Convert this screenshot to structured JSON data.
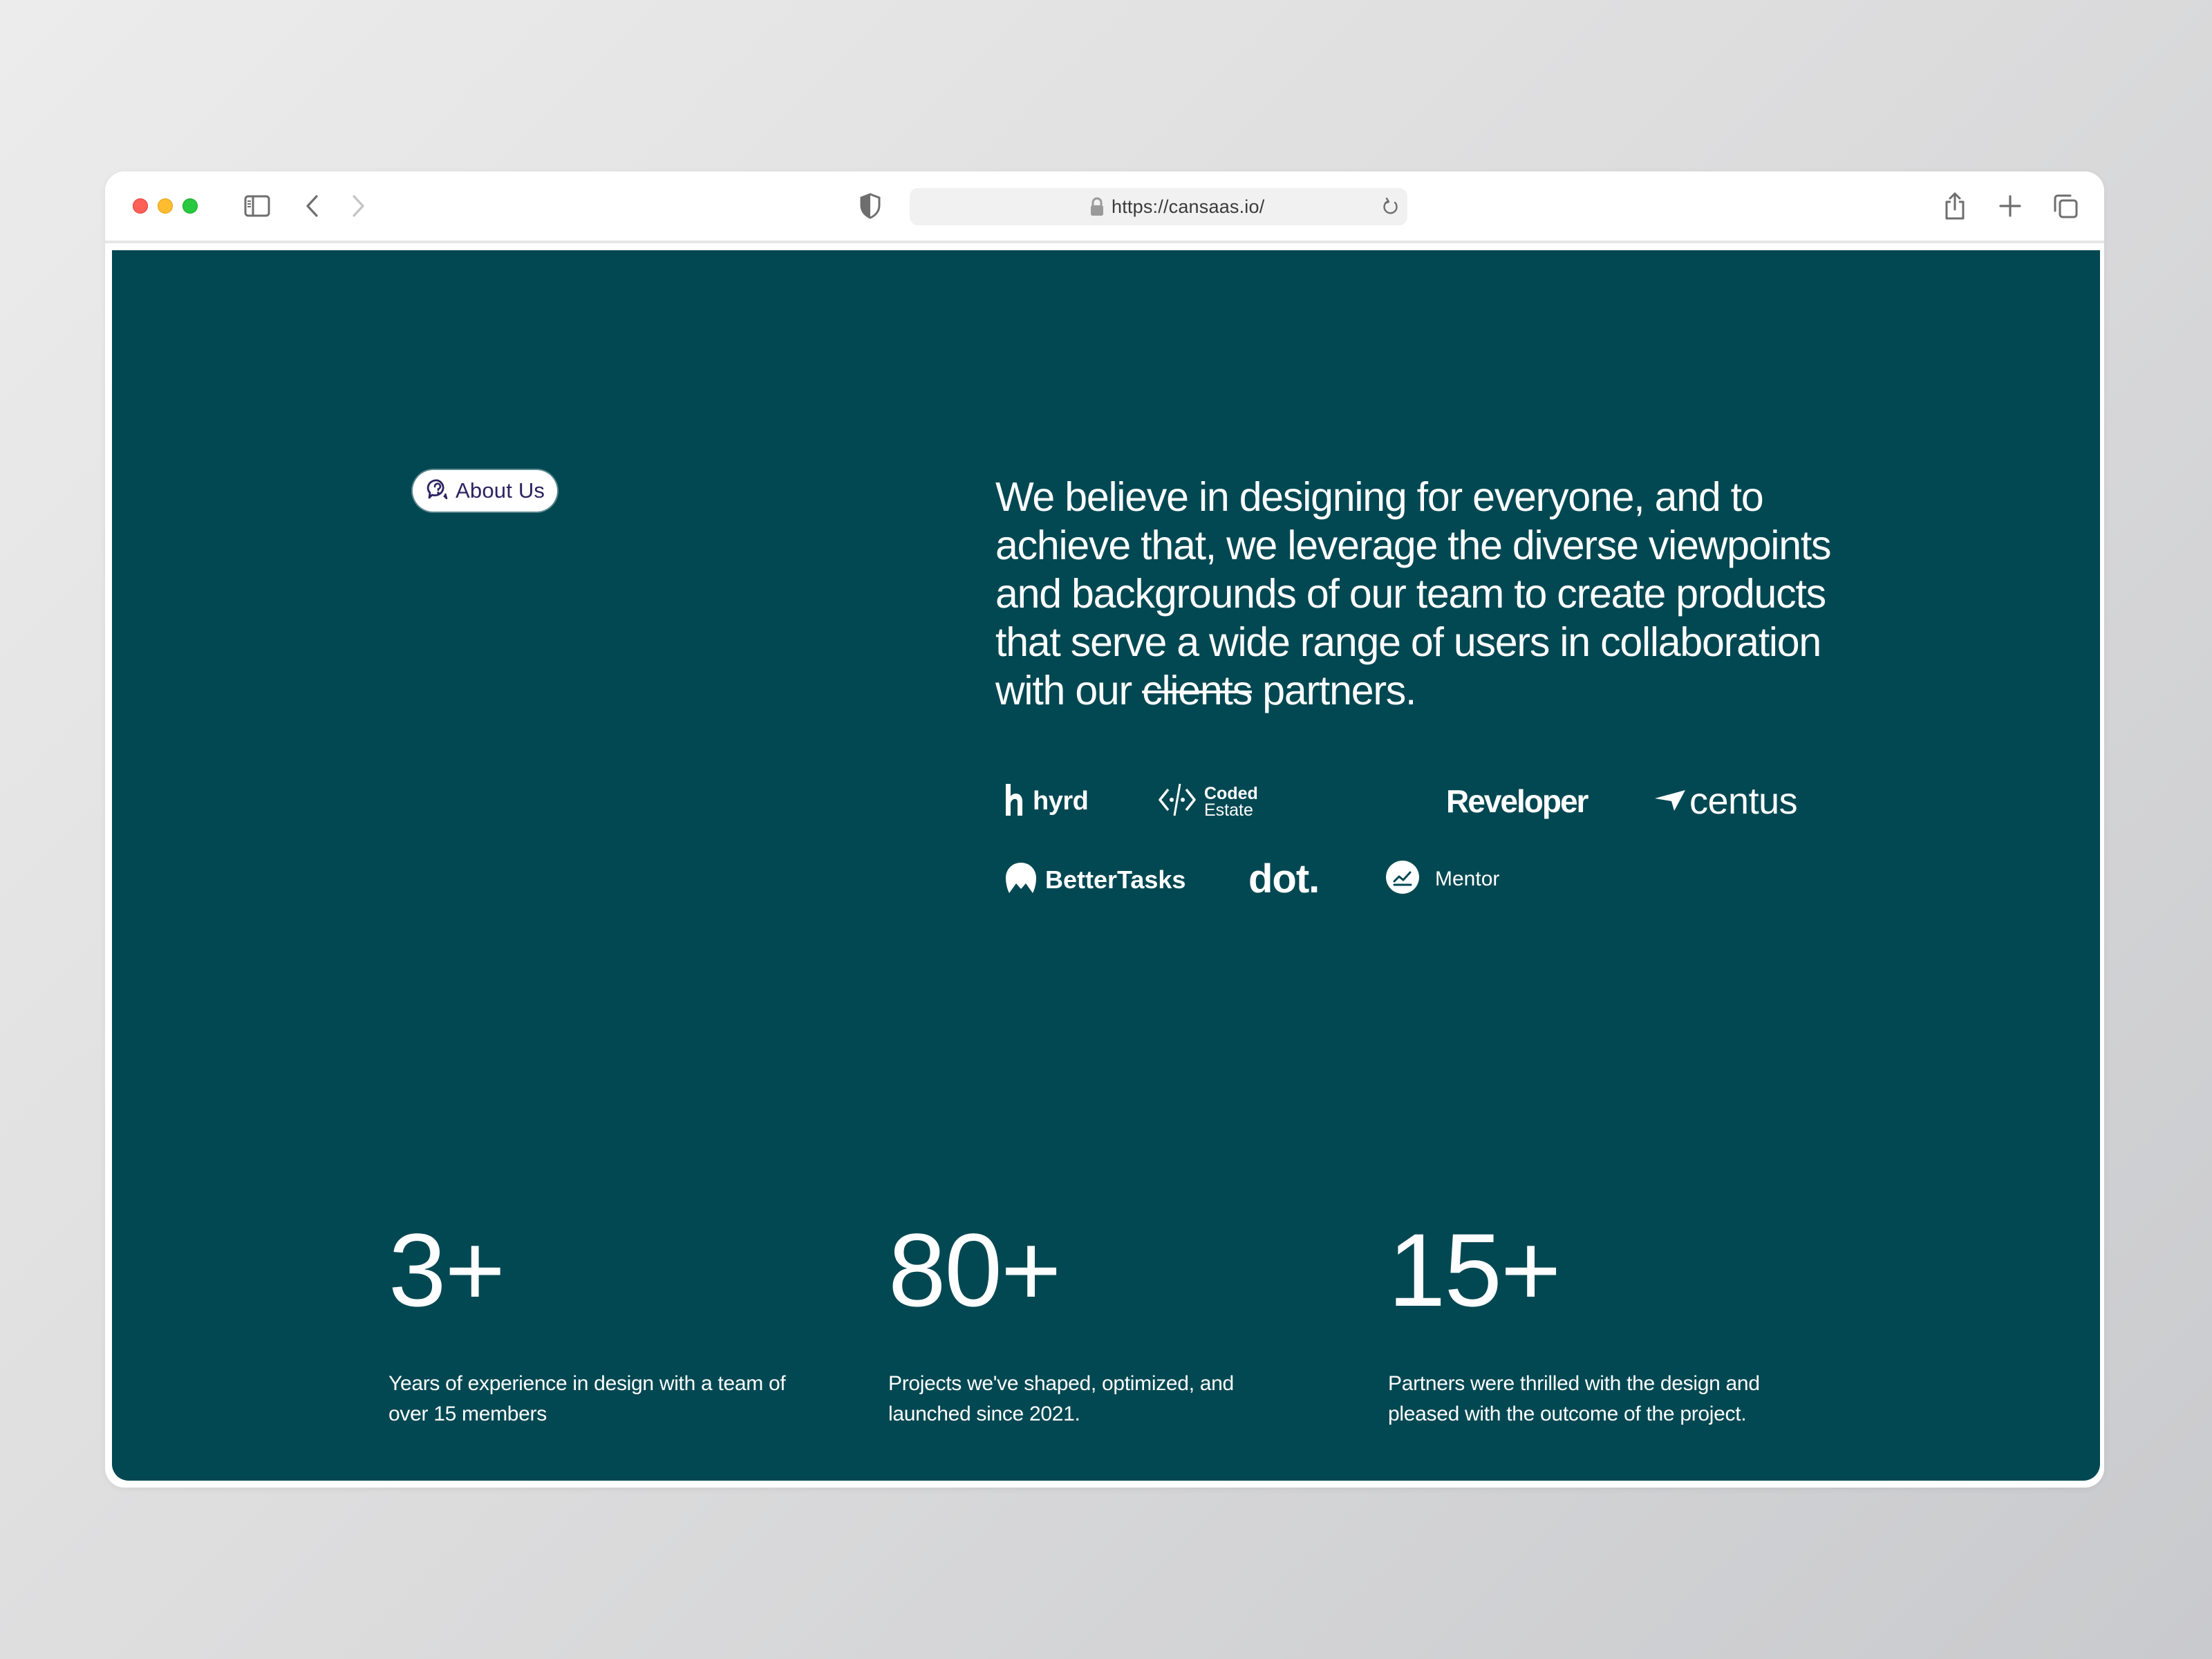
{
  "browser": {
    "url": "https://cansaas.io/",
    "icons": {
      "sidebar": "sidebar-icon",
      "back": "chevron-left-icon",
      "forward": "chevron-right-icon",
      "privacy": "shield-icon",
      "lock": "lock-icon",
      "reload": "reload-icon",
      "share": "share-icon",
      "new_tab": "plus-icon",
      "tabs": "tabs-overview-icon"
    }
  },
  "page": {
    "background_color": "#024852",
    "badge": {
      "label": "About Us",
      "icon": "question-chat-icon"
    },
    "headline": {
      "before": "We believe in designing for everyone, and to achieve that, we leverage the diverse viewpoints and backgrounds of our team to create products that serve a wide range of users in collaboration with our ",
      "struck": "clients",
      "after": " partners."
    },
    "partners": [
      {
        "name": "hyrd",
        "icon": "hyrd-logo-icon"
      },
      {
        "name_line1": "Coded",
        "name_line2": "Estate",
        "icon": "code-brackets-icon"
      },
      {
        "name": "Reveloper"
      },
      {
        "name": "centus",
        "icon": "centus-wing-icon"
      },
      {
        "name": "BetterTasks",
        "icon": "bettertasks-logo-icon"
      },
      {
        "name": "dot."
      },
      {
        "name": "Mentor",
        "icon": "trend-chart-icon"
      }
    ],
    "stats": [
      {
        "value": "3+",
        "description": "Years of experience in design with a team of over 15 members"
      },
      {
        "value": "80+",
        "description": "Projects we've shaped, optimized, and launched since 2021."
      },
      {
        "value": "15+",
        "description": "Partners were thrilled with the design and pleased with the outcome of the project."
      }
    ]
  }
}
